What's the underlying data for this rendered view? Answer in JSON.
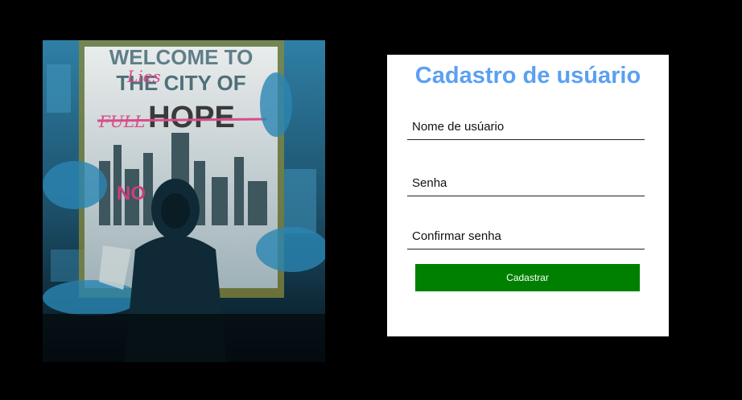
{
  "poster": {
    "line1": "WELCOME TO",
    "line2": "THE CITY OF",
    "line3": "HOPE",
    "graffiti_top": "Lies",
    "graffiti_mid": "FULL",
    "graffiti_no": "NO"
  },
  "form": {
    "title": "Cadastro de usúario",
    "username_placeholder": "Nome de usúario",
    "password_placeholder": "Senha",
    "confirm_placeholder": "Confirmar senha",
    "submit_label": "Cadastrar"
  },
  "colors": {
    "background": "#000000",
    "title": "#5ba0f2",
    "button": "#008000"
  }
}
